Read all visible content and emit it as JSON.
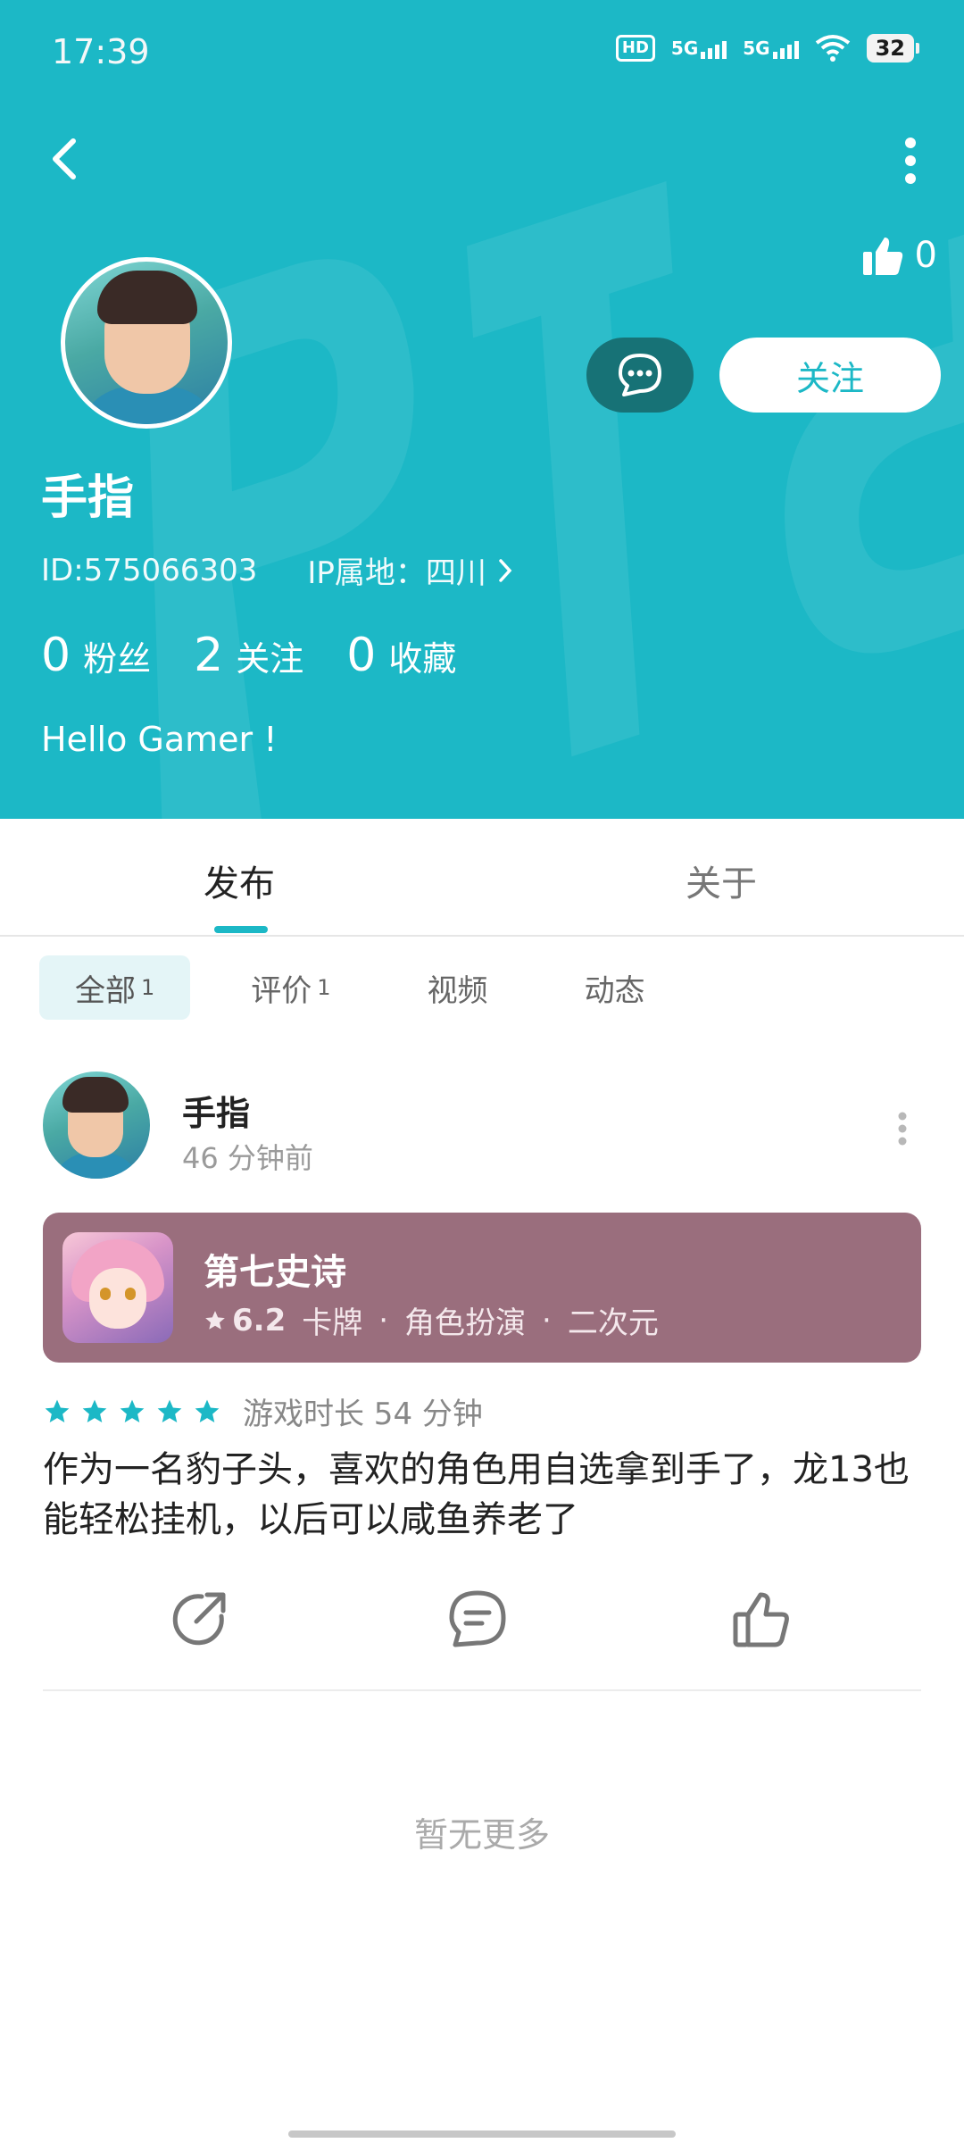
{
  "status_bar": {
    "time": "17:39",
    "battery": "32",
    "hd_label": "HD",
    "sig1": "5G",
    "sig2": "5G"
  },
  "profile": {
    "like_count": "0",
    "message_icon": "chat-bubble-icon",
    "follow_label": "关注",
    "username": "手指",
    "id_text": "ID:575066303",
    "ip_text": "IP属地：四川",
    "stats": [
      {
        "num": "0",
        "label": "粉丝"
      },
      {
        "num": "2",
        "label": "关注"
      },
      {
        "num": "0",
        "label": "收藏"
      }
    ],
    "bio": "Hello Gamer !"
  },
  "tabs": {
    "publish": "发布",
    "about": "关于"
  },
  "filters": [
    {
      "label": "全部",
      "count": "1"
    },
    {
      "label": "评价",
      "count": "1"
    },
    {
      "label": "视频",
      "count": ""
    },
    {
      "label": "动态",
      "count": ""
    }
  ],
  "post": {
    "author": "手指",
    "time": "46 分钟前",
    "game": {
      "title": "第七史诗",
      "rating": "6.2",
      "tags": [
        "卡牌",
        "角色扮演",
        "二次元"
      ],
      "separator": "·"
    },
    "stars": 5,
    "playtime": "游戏时长 54 分钟",
    "text": "作为一名豹子头，喜欢的角色用自选拿到手了，龙13也能轻松挂机，以后可以咸鱼养老了"
  },
  "footer": {
    "no_more": "暂无更多"
  },
  "colors": {
    "accent": "#1cb8c6",
    "card": "#9a6e7d"
  }
}
